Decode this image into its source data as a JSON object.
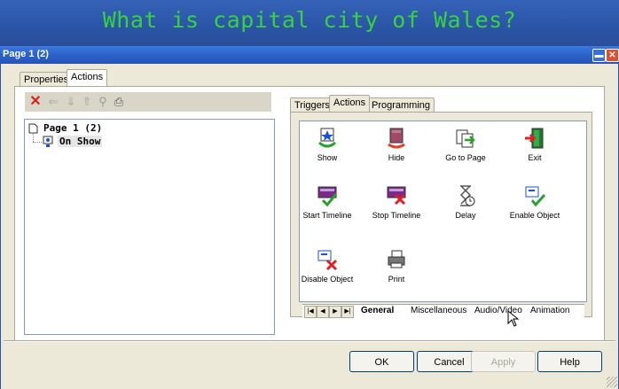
{
  "banner": {
    "question": "What is capital city of Wales?"
  },
  "window": {
    "title": "Page 1 (2)",
    "minimize_glyph": "▬",
    "close_glyph": "✕"
  },
  "top_tabs": [
    "Properties",
    "Actions"
  ],
  "toolbar": {
    "icons": [
      "delete-icon",
      "arrow-left-icon",
      "arrow-down-icon",
      "arrow-up-icon",
      "properties-icon",
      "print-icon"
    ]
  },
  "tree": {
    "root": "Page 1 (2)",
    "child": "On Show"
  },
  "right_tabs": [
    "Triggers",
    "Actions",
    "Programming"
  ],
  "actions": [
    {
      "label": "Show"
    },
    {
      "label": "Hide"
    },
    {
      "label": "Go to Page"
    },
    {
      "label": "Exit"
    },
    {
      "label": "Start Timeline"
    },
    {
      "label": "Stop Timeline"
    },
    {
      "label": "Delay"
    },
    {
      "label": "Enable Object"
    },
    {
      "label": "Disable Object"
    },
    {
      "label": "Print"
    }
  ],
  "bottom_tabs": [
    "General",
    "Miscellaneous",
    "Audio/Video",
    "Animation"
  ],
  "buttons": {
    "ok": "OK",
    "cancel": "Cancel",
    "apply": "Apply",
    "help": "Help"
  },
  "colors": {
    "banner_text": "#35d43c",
    "titlebar": "#2b62c8",
    "delete_x": "#e02020",
    "check": "#2aa02a"
  }
}
